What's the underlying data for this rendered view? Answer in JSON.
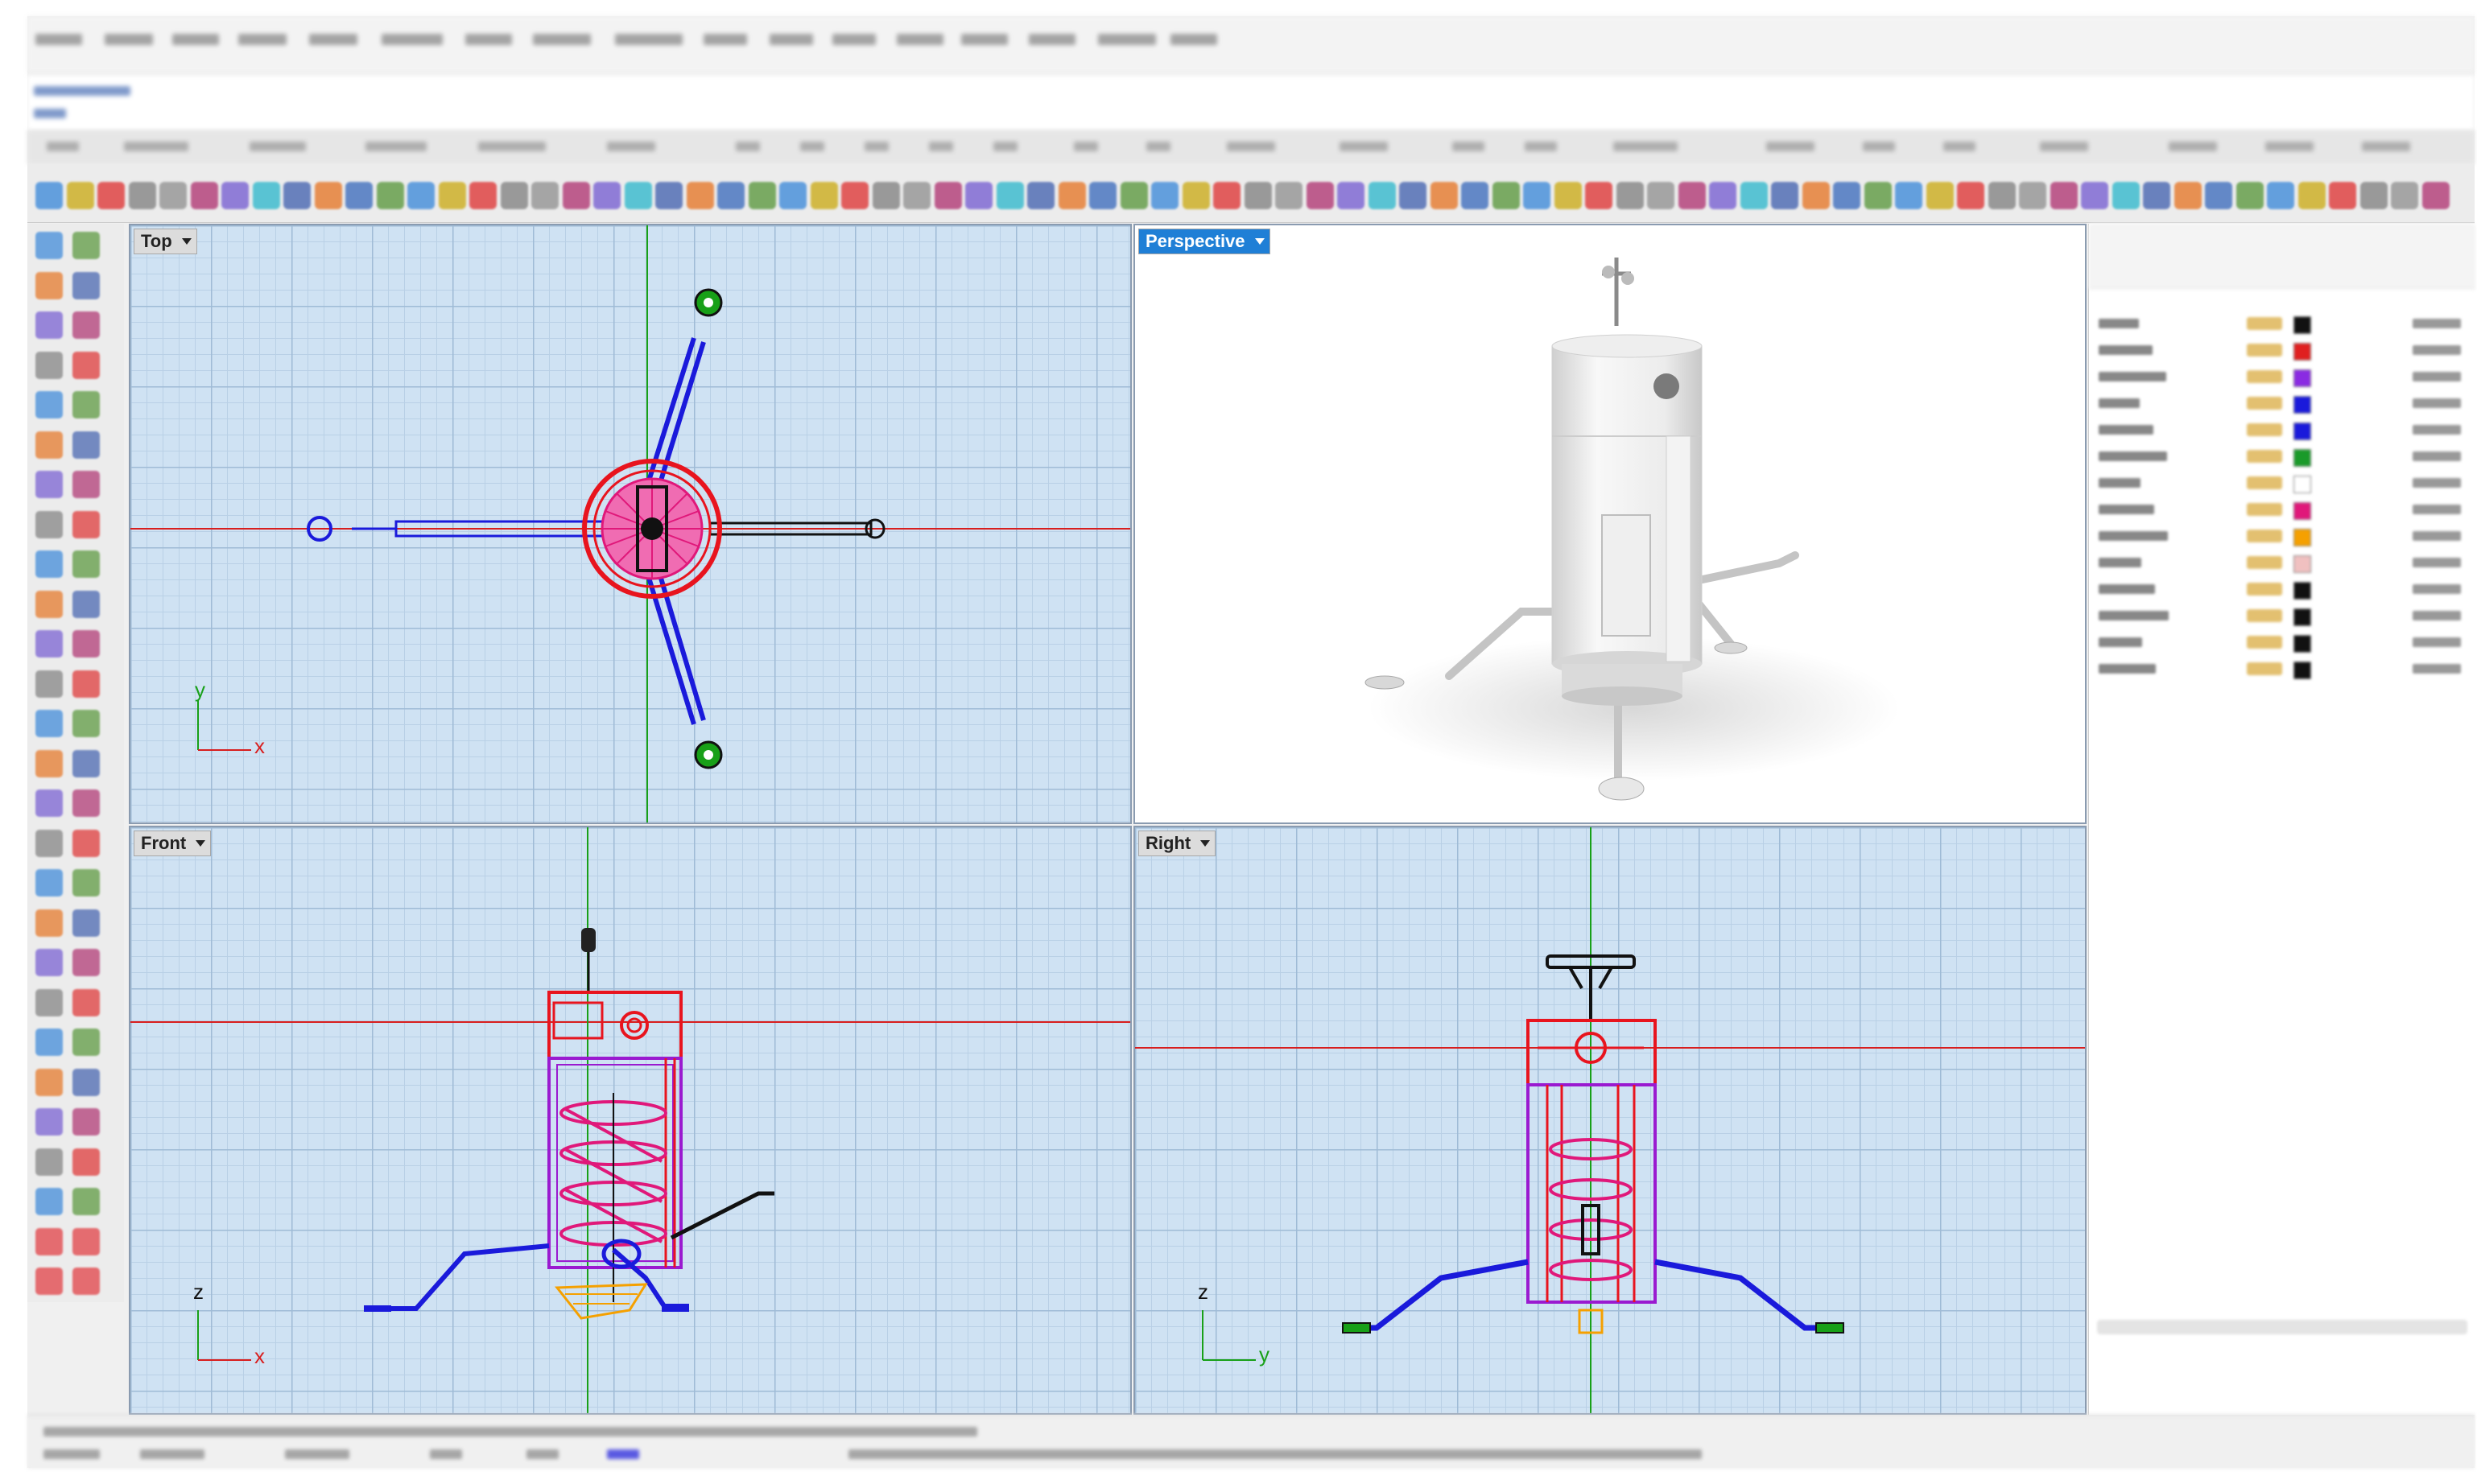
{
  "viewports": {
    "top": {
      "label": "Top",
      "axis_x": "x",
      "axis_y": "y"
    },
    "perspective": {
      "label": "Perspective"
    },
    "front": {
      "label": "Front",
      "axis_x": "x",
      "axis_z": "z"
    },
    "right": {
      "label": "Right",
      "axis_y": "y",
      "axis_z": "z"
    }
  },
  "colors": {
    "active_viewport": "#1f7fd6",
    "grid_bg": "#cfe2f3",
    "x_axis": "#d81e1e",
    "y_axis": "#18a018",
    "wire_blue": "#1a1adb",
    "wire_red": "#e8141e",
    "wire_magenta": "#e0187a",
    "wire_purple": "#9a1ad0"
  },
  "layers_panel": {
    "swatches": [
      "#111111",
      "#e02020",
      "#8a2be2",
      "#1a1adb",
      "#1a1adb",
      "#1a9a2a",
      "#ffffff",
      "#e0187a",
      "#f5a000",
      "#f0c0c0",
      "#111111",
      "#111111",
      "#111111",
      "#111111"
    ]
  }
}
